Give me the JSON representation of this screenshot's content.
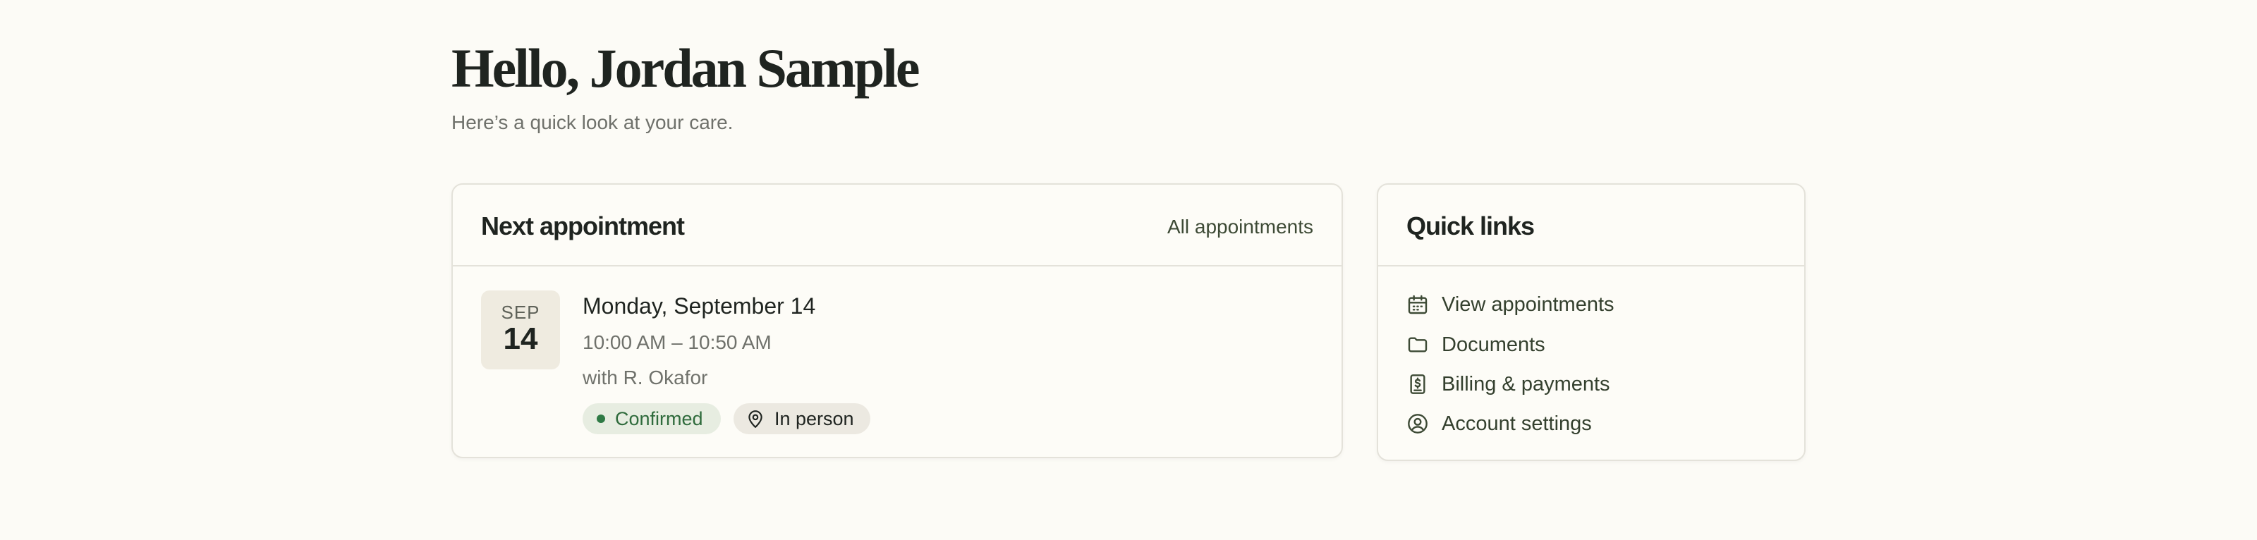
{
  "header": {
    "greeting": "Hello, Jordan Sample",
    "subtitle": "Here’s a quick look at your care."
  },
  "next_appointment": {
    "title": "Next appointment",
    "all_link": "All appointments",
    "month": "SEP",
    "day": "14",
    "date_text": "Monday, September 14",
    "time_text": "10:00 AM – 10:50 AM",
    "provider_text": "with R. Okafor",
    "status_badge": "Confirmed",
    "location_badge": "In person"
  },
  "quick_links": {
    "title": "Quick links",
    "items": [
      {
        "label": "View appointments",
        "icon": "calendar-icon"
      },
      {
        "label": "Documents",
        "icon": "folder-icon"
      },
      {
        "label": "Billing & payments",
        "icon": "dollar-document-icon"
      },
      {
        "label": "Account settings",
        "icon": "user-circle-icon"
      }
    ]
  },
  "colors": {
    "background": "#fcfbf6",
    "accent": "#3d4a35",
    "status_confirmed": "#2f6b3c",
    "date_tile": "#efebe0"
  }
}
